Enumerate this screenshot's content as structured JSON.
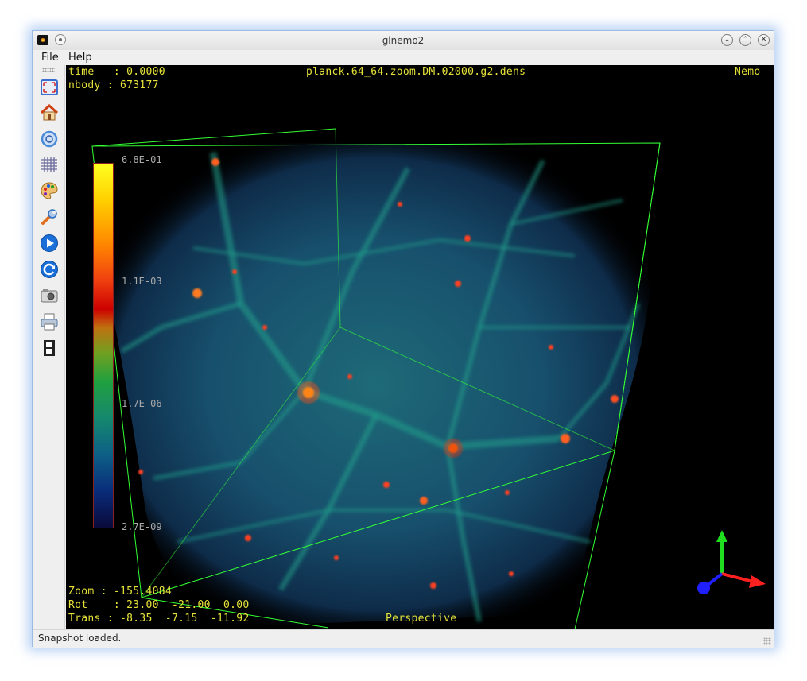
{
  "window": {
    "title": "glnemo2"
  },
  "menu": {
    "file": "File",
    "help": "Help"
  },
  "toolbar": {
    "tools": [
      {
        "name": "fullscreen-icon",
        "color": "#3a6fd0"
      },
      {
        "name": "home-icon",
        "color": "#e05a20"
      },
      {
        "name": "zoom-icon",
        "color": "#4a8ad8"
      },
      {
        "name": "grid-icon",
        "color": "#6a6a9a"
      },
      {
        "name": "palette-icon",
        "color": "#e0a040"
      },
      {
        "name": "wrench-icon",
        "color": "#3070c0"
      },
      {
        "name": "play-icon",
        "color": "#1a70d8"
      },
      {
        "name": "reload-icon",
        "color": "#1a70d8"
      },
      {
        "name": "camera-icon",
        "color": "#707070"
      },
      {
        "name": "printer-icon",
        "color": "#5a7aa0"
      },
      {
        "name": "film-icon",
        "color": "#222222"
      }
    ]
  },
  "viewport": {
    "time_line": "time   : 0.0000",
    "nbody_line": "nbody : 673177",
    "filename": "planck.64_64.zoom.DM.02000.g2.dens",
    "corner_label": "Nemo",
    "zoom_line": "Zoom : -155.4084",
    "rot_line": "Rot    : 23.00  -21.00  0.00",
    "trans_line": "Trans : -8.35  -7.15  -11.92",
    "projection": "Perspective",
    "colorbar_labels": [
      "6.8E-01",
      "1.1E-03",
      "1.7E-06",
      "2.7E-09"
    ]
  },
  "status": {
    "message": "Snapshot loaded."
  },
  "colors": {
    "hud_text": "#e6e23a",
    "box_edges": "#33ff33",
    "axis_x": "#ff2020",
    "axis_y": "#20dd20",
    "axis_z": "#2020ff"
  }
}
